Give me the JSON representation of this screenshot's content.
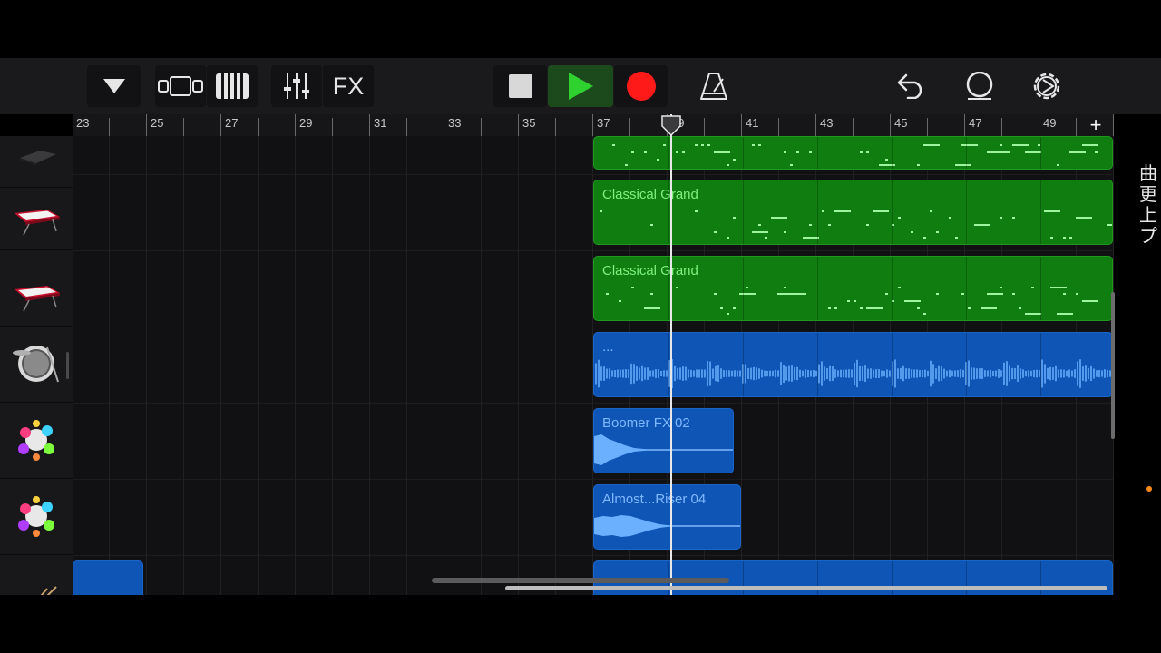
{
  "toolbar": {
    "fx_label": "FX",
    "icons": [
      "dropdown-triangle-icon",
      "track-view-icon",
      "keyboard-icon",
      "mixer-sliders-icon",
      "stop-icon",
      "play-icon",
      "record-icon",
      "metronome-icon",
      "undo-icon",
      "loop-browser-icon",
      "settings-icon"
    ]
  },
  "ruler": {
    "bars": [
      "23",
      "25",
      "27",
      "29",
      "31",
      "33",
      "35",
      "37",
      "39",
      "41",
      "43",
      "45",
      "47",
      "49"
    ],
    "add_label": "+"
  },
  "tracks": [
    {
      "instrument": "drum-machine-icon"
    },
    {
      "instrument": "red-keyboard-icon"
    },
    {
      "instrument": "red-keyboard-icon"
    },
    {
      "instrument": "drum-kit-icon"
    },
    {
      "instrument": "fx-sparkle-icon"
    },
    {
      "instrument": "fx-sparkle-icon"
    },
    {
      "instrument": "snare-drum-icon"
    }
  ],
  "regions": {
    "grand1": "Classical Grand",
    "grand2": "Classical Grand",
    "drums": "...",
    "fx1": "Boomer FX 02",
    "fx2": "Almost...Riser 04"
  },
  "side_text": [
    "曲",
    "更",
    "上",
    "プ"
  ],
  "colors": {
    "midi_region": "#0f7d10",
    "audio_region": "#0e55b6",
    "play": "#2fd12f",
    "record": "#ff1a1a",
    "indicator_dot": "#ff8c1a"
  }
}
